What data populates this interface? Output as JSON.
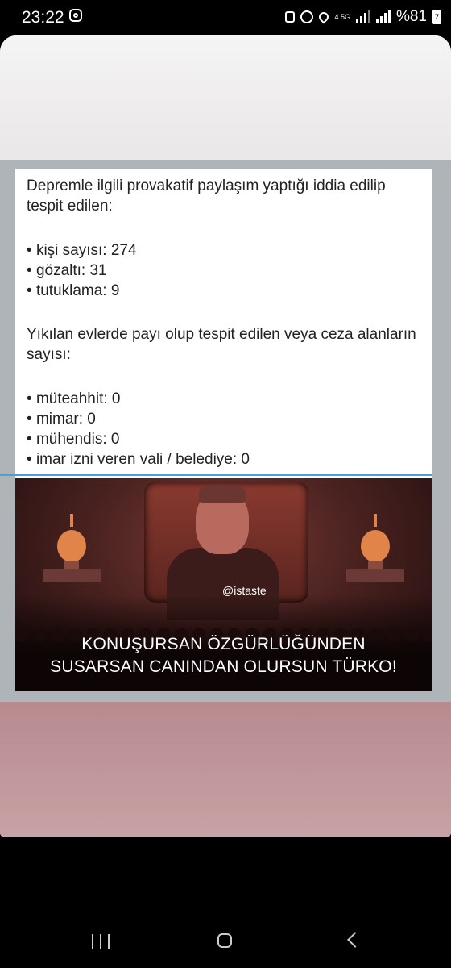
{
  "status_bar": {
    "time": "23:22",
    "network": "4.5G",
    "battery_percent": "%81",
    "battery_badge": "7"
  },
  "post": {
    "paragraph1": "Depremle ilgili provakatif paylaşım yaptığı iddia edilip tespit edilen:",
    "list1": [
      "kişi sayısı: 274",
      "gözaltı: 31",
      "tutuklama: 9"
    ],
    "paragraph2": "Yıkılan evlerde payı olup tespit edilen veya ceza alanların sayısı:",
    "list2": [
      "müteahhit: 0",
      "mimar: 0",
      "mühendis: 0",
      "imar izni veren vali / belediye: 0"
    ]
  },
  "meme": {
    "watermark": "@istaste",
    "caption_line1": "KONUŞURSAN ÖZGÜRLÜĞÜNDEN",
    "caption_line2": "SUSARSAN CANINDAN OLURSUN TÜRKO!"
  },
  "colors": {
    "divider": "#4aa0d8",
    "bottom_band": "#c8a2a6"
  },
  "nav": {
    "icons": [
      "recents-icon",
      "home-icon",
      "back-icon"
    ]
  }
}
